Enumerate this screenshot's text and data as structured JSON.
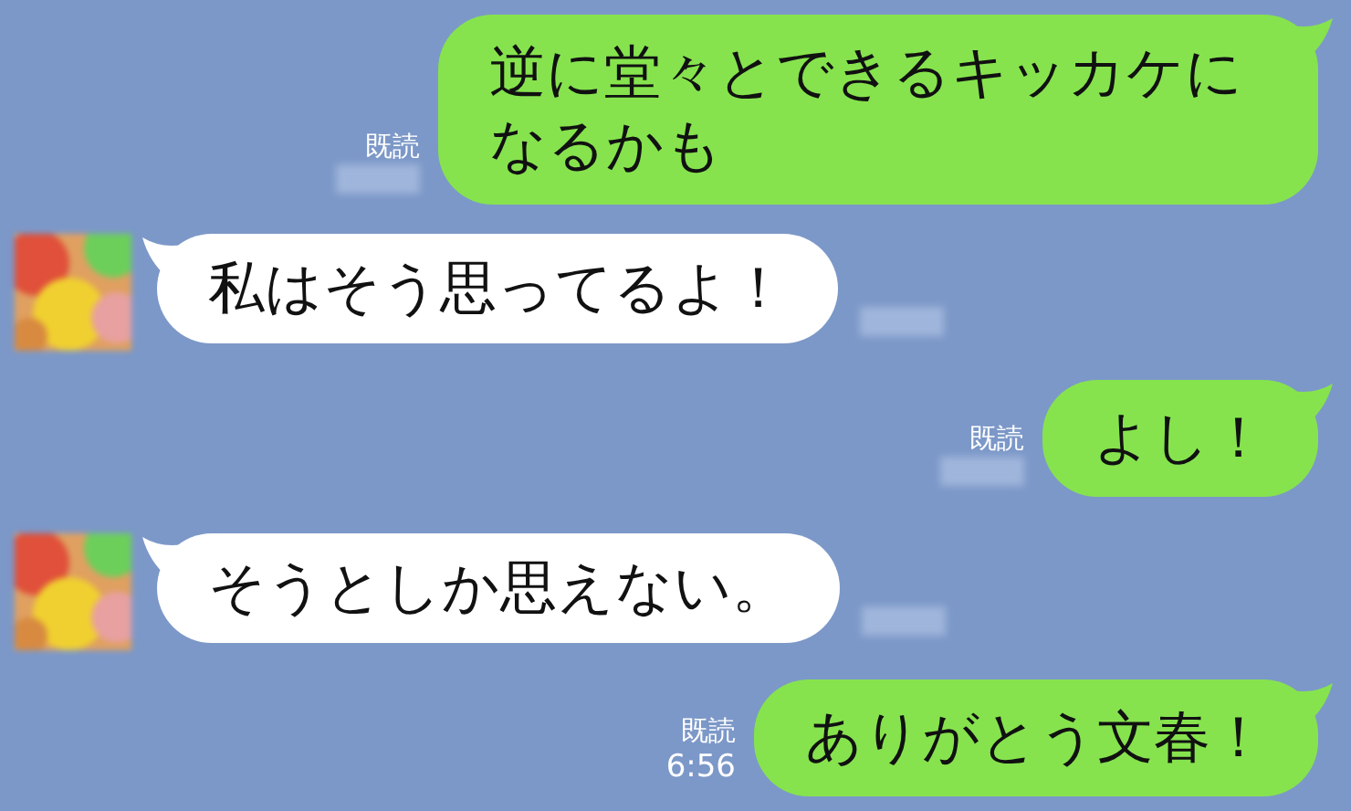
{
  "messages": [
    {
      "kind": "outgoing",
      "text": "逆に堂々とできるキッカケになるかも",
      "read_label": "既読"
    },
    {
      "kind": "incoming",
      "text": "私はそう思ってるよ！"
    },
    {
      "kind": "outgoing",
      "text": "よし！",
      "read_label": "既読"
    },
    {
      "kind": "incoming",
      "text": "そうとしか思えない。"
    },
    {
      "kind": "outgoing",
      "text": "ありがとう文春！",
      "read_label": "既読",
      "time": "6:56"
    }
  ]
}
